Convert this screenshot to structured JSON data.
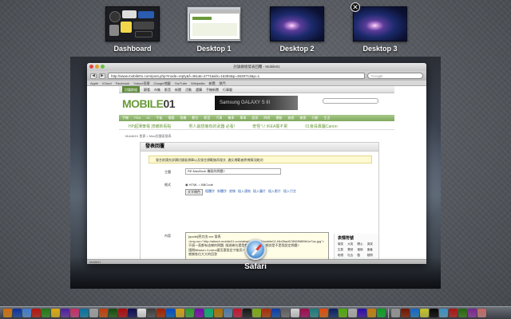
{
  "spaces": [
    {
      "label": "Dashboard"
    },
    {
      "label": "Desktop 1"
    },
    {
      "label": "Desktop 2"
    },
    {
      "label": "Desktop 3"
    }
  ],
  "close_glyph": "✕",
  "active_app": {
    "label": "Safari",
    "icon": "safari-compass-icon"
  },
  "safari": {
    "window_title": "討論群組發表回覆 - Mobile01",
    "url": "http://www.mobile01.com/post.php?mode=reply&f=461&t=2771&idx=16394&p=3629713&p=1",
    "search_placeholder": "Google",
    "back": "◀",
    "forward": "▶",
    "bookmarks": [
      "Apple",
      "iCloud",
      "Facebook",
      "Yahoo!奇摩",
      "Google地圖",
      "YouTube",
      "Wikipedia",
      "新聞",
      "熱門"
    ],
    "status_text": "Mobile01"
  },
  "site": {
    "nav": [
      "討論群組",
      "觀看",
      "市集",
      "影音",
      "新聞",
      "活動",
      "選購",
      "手機新聞",
      "行事曆"
    ],
    "nav_active": "討論群組",
    "logo_main": "MOBILE",
    "logo_num": "01",
    "banner_text": "Samsung GALAXY S III",
    "category_nav": [
      "手機",
      "PDA",
      "3C",
      "平板",
      "電腦",
      "相機",
      "數位",
      "影音",
      "汽車",
      "機車",
      "單車",
      "居家",
      "時尚",
      "運動",
      "旅遊",
      "美食",
      "行動",
      "生活"
    ],
    "promos": [
      "HP超薄筆電 誇耀新看點",
      "男人最想擁有的武器 必看!",
      "奇怪ㄟ! IKEA擺不累",
      "01會員專屬Canon"
    ],
    "breadcrumb": "Mobile01 首頁 > Mac討論區發表",
    "post": {
      "heading": "發表回覆",
      "notice": "發言前請先詳讀討論區規章以及發言規範後再發文, 違反規範者將視情況刪文!",
      "subject_label": "主題",
      "subject_value": "RE:MacBook 機殼的問題?",
      "format_label": "格式",
      "format_html": "HTML",
      "format_bbcode": "BBCode",
      "font_select": "文字顏色",
      "editor_links": [
        "粗體字",
        "斜體字",
        "底線",
        "插入連結",
        "插入圖片",
        "插入影片",
        "插入引言"
      ],
      "content_label": "內容",
      "content_text": "[quote]原文由 xxx 發表\n<img src=\"http://attach.mobile01.com/attach/201206/mobile01-f4b05ad67896f98f9fb1e7ac.jpg\">\n不過一直都有這樣的問題, 換過幾台還是都有同樣狀況, 想說是不是我設定問題?\n請問Mission Control要怎麼設定才能用?\n感謝各位大大的回答",
      "emoji_title": "表情符號",
      "emoji": [
        "微笑",
        "大笑",
        "開心",
        "哭哭",
        "生氣",
        "驚訝",
        "暈倒",
        "害羞",
        "眨眼",
        "吐舌",
        "酷",
        "疑問",
        "無奈",
        "愛心",
        "讚",
        "噓",
        "再見",
        "拜託",
        "汗",
        "睡覺"
      ]
    }
  },
  "dock_colors": [
    "#e8a53a",
    "#3a6fc8",
    "#7bb0e8",
    "#d84a3a",
    "#5ab04a",
    "#f0d040",
    "#8a5ac8",
    "#e06aa0",
    "#3aa8c8",
    "#c8c8c8",
    "#e07a3a",
    "#4a8a3a",
    "#d03a3a",
    "#3a3a8a",
    "#f0f0f0",
    "#7a7a7a",
    "#c85a2a",
    "#2a8ae0",
    "#e8c84a",
    "#6ac86a",
    "#a83ad0",
    "#3ad0a8",
    "#d0a83a",
    "#8ab0d0",
    "#e04a6a",
    "#4a4a4a",
    "#b0d04a",
    "#d06a3a",
    "#3a7ad0",
    "#9a9a9a",
    "#e8e8e8",
    "#c83a8a",
    "#5ab0b0",
    "#f08a3a",
    "#3a5a9a",
    "#8ad03a",
    "#d0d0d0",
    "#6a3ad0",
    "#e0b03a",
    "#3ac85a",
    "#c0c0c0",
    "#aa4a2a",
    "#4aa0e0",
    "#e0e060",
    "#2a2a2a",
    "#7ac0e0",
    "#d04a4a",
    "#60a040",
    "#b060c0",
    "#e0a0a0"
  ]
}
